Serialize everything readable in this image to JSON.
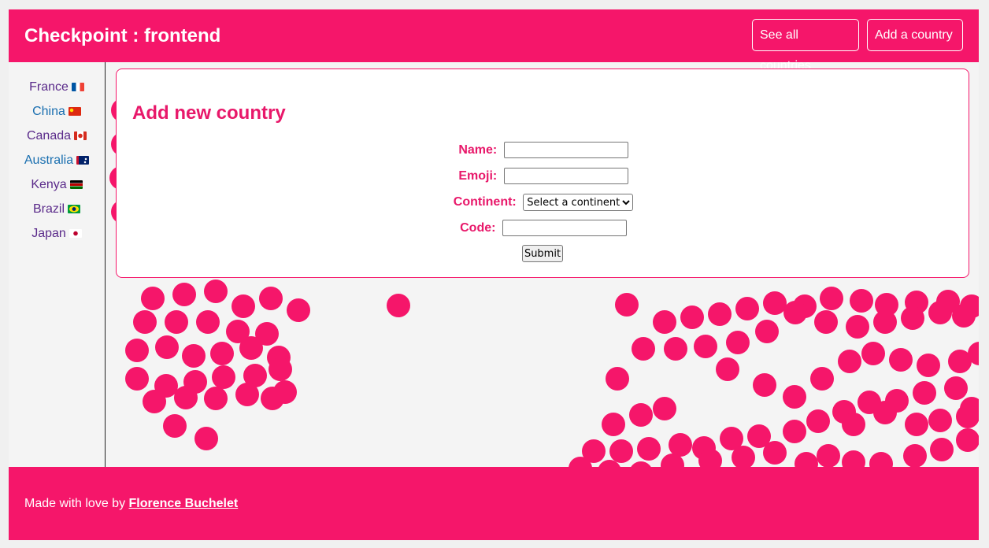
{
  "header": {
    "title": "Checkpoint : frontend",
    "nav": {
      "see_all": "See all countries",
      "add": "Add a country"
    }
  },
  "sidebar": {
    "countries": [
      {
        "name": "France",
        "flag_icon": "france-flag-icon"
      },
      {
        "name": "China",
        "flag_icon": "china-flag-icon"
      },
      {
        "name": "Canada",
        "flag_icon": "canada-flag-icon"
      },
      {
        "name": "Australia",
        "flag_icon": "australia-flag-icon"
      },
      {
        "name": "Kenya",
        "flag_icon": "kenya-flag-icon"
      },
      {
        "name": "Brazil",
        "flag_icon": "brazil-flag-icon"
      },
      {
        "name": "Japan",
        "flag_icon": "japan-flag-icon"
      }
    ]
  },
  "form": {
    "heading": "Add new country",
    "name_label": "Name:",
    "name_value": "",
    "emoji_label": "Emoji:",
    "emoji_value": "",
    "continent_label": "Continent:",
    "continent_selected": "Select a continent",
    "code_label": "Code:",
    "code_value": "",
    "submit_label": "Submit"
  },
  "footer": {
    "prefix": "Made with love by ",
    "author": "Florence Buchelet"
  },
  "colors": {
    "brand": "#f5166a",
    "link_visited": "#5a2a8a",
    "link": "#1a6fb0"
  }
}
